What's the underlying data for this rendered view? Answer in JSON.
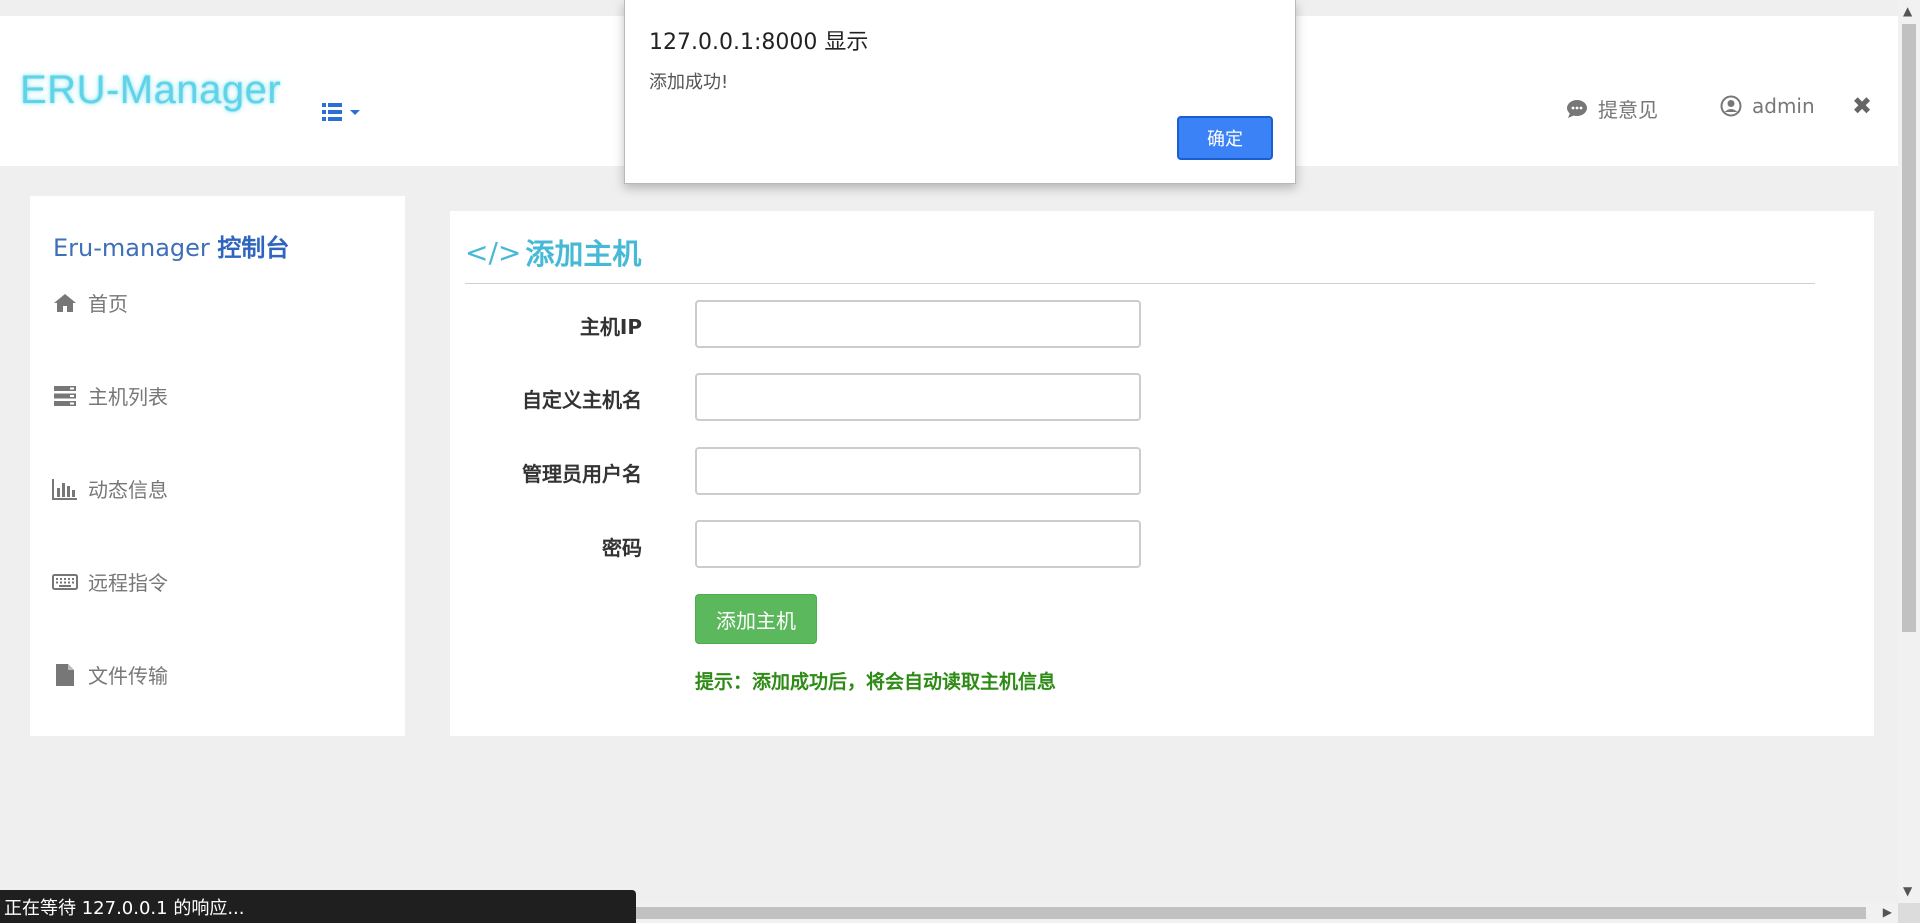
{
  "header": {
    "logo": "ERU-Manager",
    "feedback_label": "提意见",
    "user_label": "admin",
    "close_glyph": "✖",
    "icons": [
      "list-icon",
      "comment-icon",
      "user-circle-icon",
      "close-icon"
    ]
  },
  "sidebar": {
    "title_prefix": "Eru-manager ",
    "title_bold": "控制台",
    "items": [
      {
        "label": "首页",
        "icon": "home-icon"
      },
      {
        "label": "主机列表",
        "icon": "server-icon"
      },
      {
        "label": "动态信息",
        "icon": "bar-chart-icon"
      },
      {
        "label": "远程指令",
        "icon": "keyboard-icon"
      },
      {
        "label": "文件传输",
        "icon": "file-icon"
      }
    ]
  },
  "panel": {
    "title_code": "</>",
    "title": "添加主机",
    "fields": [
      {
        "label": "主机IP",
        "value": ""
      },
      {
        "label": "自定义主机名",
        "value": ""
      },
      {
        "label": "管理员用户名",
        "value": ""
      },
      {
        "label": "密码",
        "value": ""
      }
    ],
    "submit_label": "添加主机",
    "hint": "提示：添加成功后，将会自动读取主机信息"
  },
  "dialog": {
    "title": "127.0.0.1:8000 显示",
    "message": "添加成功!",
    "ok_label": "确定"
  },
  "status": {
    "text": "正在等待 127.0.0.1 的响应..."
  },
  "colors": {
    "accent": "#46b9d6",
    "sidebar_title": "#2f64bf",
    "success_button": "#5cb85c",
    "hint_text": "#2e8b16",
    "dialog_button": "#3b82f6"
  }
}
